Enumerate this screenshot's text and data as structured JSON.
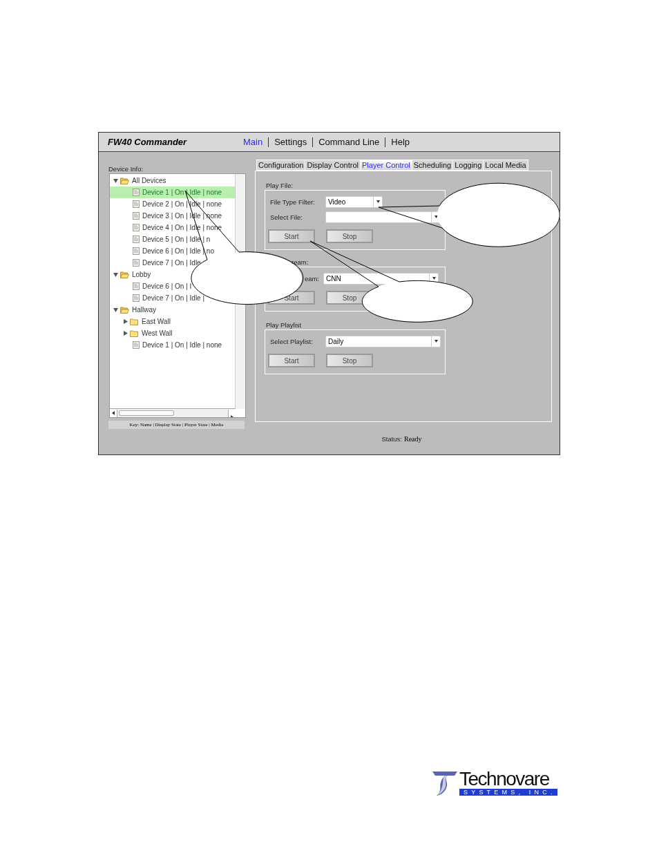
{
  "window": {
    "title": "FW40 Commander"
  },
  "menu": [
    {
      "label": "Main",
      "selected": true
    },
    {
      "label": "Settings",
      "selected": false
    },
    {
      "label": "Command Line",
      "selected": false
    },
    {
      "label": "Help",
      "selected": false
    }
  ],
  "device_panel": {
    "title": "Device Info:",
    "key": "Key: Name | Display State | Player State | Media"
  },
  "tree": {
    "items": [
      {
        "label": "All Devices",
        "kind": "folder",
        "expanded": true,
        "selected": false,
        "children": [
          {
            "label": "Device 1 | On | Idle | none",
            "kind": "file",
            "selected": true
          },
          {
            "label": "Device 2 | On | Idle | none",
            "kind": "file",
            "selected": false
          },
          {
            "label": "Device 3 | On | Idle | none",
            "kind": "file",
            "selected": false
          },
          {
            "label": "Device 4 | On | Idle | none",
            "kind": "file",
            "selected": false
          },
          {
            "label": "Device 5 | On | Idle | n",
            "kind": "file",
            "selected": false
          },
          {
            "label": "Device 6 | On | Idle | no",
            "kind": "file",
            "selected": false
          },
          {
            "label": "Device 7 | On | Idle",
            "kind": "file",
            "selected": false
          }
        ]
      },
      {
        "label": "Lobby",
        "kind": "folder",
        "expanded": true,
        "selected": false,
        "children": [
          {
            "label": "Device 6 | On | I",
            "kind": "file",
            "selected": false
          },
          {
            "label": "Device 7 | On | Idle |",
            "kind": "file",
            "selected": false
          }
        ]
      },
      {
        "label": "Hallway",
        "kind": "folder",
        "expanded": true,
        "selected": false,
        "children": [
          {
            "label": "East Wall",
            "kind": "folder",
            "expanded": false,
            "selected": false
          },
          {
            "label": "West Wall",
            "kind": "folder",
            "expanded": false,
            "selected": false
          },
          {
            "label": "Device 1 | On | Idle | none",
            "kind": "file",
            "selected": false
          }
        ]
      }
    ]
  },
  "tabs": [
    {
      "label": "Configuration",
      "selected": false
    },
    {
      "label": "Display Control",
      "selected": false
    },
    {
      "label": "Player Control",
      "selected": true
    },
    {
      "label": "Scheduling",
      "selected": false
    },
    {
      "label": "Logging",
      "selected": false
    },
    {
      "label": "Local Media",
      "selected": false
    }
  ],
  "groups": [
    {
      "title": "Play File:",
      "fields": [
        {
          "label": "File Type Filter:",
          "kind": "short-select",
          "value": "Video"
        },
        {
          "label": "Select File:",
          "kind": "select"
        }
      ],
      "buttons": [
        "Start",
        "Stop"
      ]
    },
    {
      "title": "ream:",
      "fields": [
        {
          "label": "eam:",
          "kind": "select",
          "value": "CNN"
        }
      ],
      "buttons": [
        "Start",
        "Stop"
      ]
    },
    {
      "title": "Play Playlist",
      "fields": [
        {
          "label": "Select Playlist:",
          "kind": "select",
          "value": "Daily"
        }
      ],
      "buttons": [
        "Start",
        "Stop"
      ]
    }
  ],
  "status_bar": {
    "label": "Status:",
    "value": "Ready"
  },
  "logo": {
    "name": "Technovare",
    "tagline": "SYSTEMS, INC."
  }
}
